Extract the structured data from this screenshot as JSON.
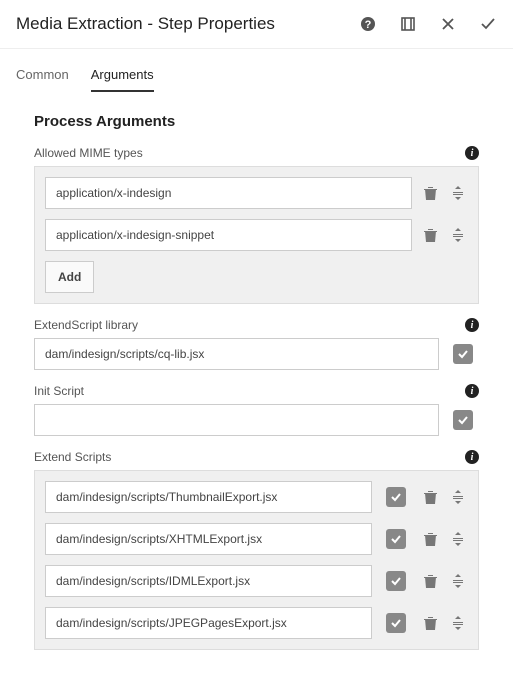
{
  "header": {
    "title": "Media Extraction - Step Properties"
  },
  "tabs": [
    {
      "label": "Common",
      "active": false
    },
    {
      "label": "Arguments",
      "active": true
    }
  ],
  "section_title": "Process Arguments",
  "fields": {
    "mime": {
      "label": "Allowed MIME types",
      "items": [
        "application/x-indesign",
        "application/x-indesign-snippet"
      ],
      "add_label": "Add"
    },
    "extendscript_lib": {
      "label": "ExtendScript library",
      "value": "dam/indesign/scripts/cq-lib.jsx"
    },
    "init_script": {
      "label": "Init Script",
      "value": ""
    },
    "extend_scripts": {
      "label": "Extend Scripts",
      "items": [
        "dam/indesign/scripts/ThumbnailExport.jsx",
        "dam/indesign/scripts/XHTMLExport.jsx",
        "dam/indesign/scripts/IDMLExport.jsx",
        "dam/indesign/scripts/JPEGPagesExport.jsx"
      ]
    }
  }
}
